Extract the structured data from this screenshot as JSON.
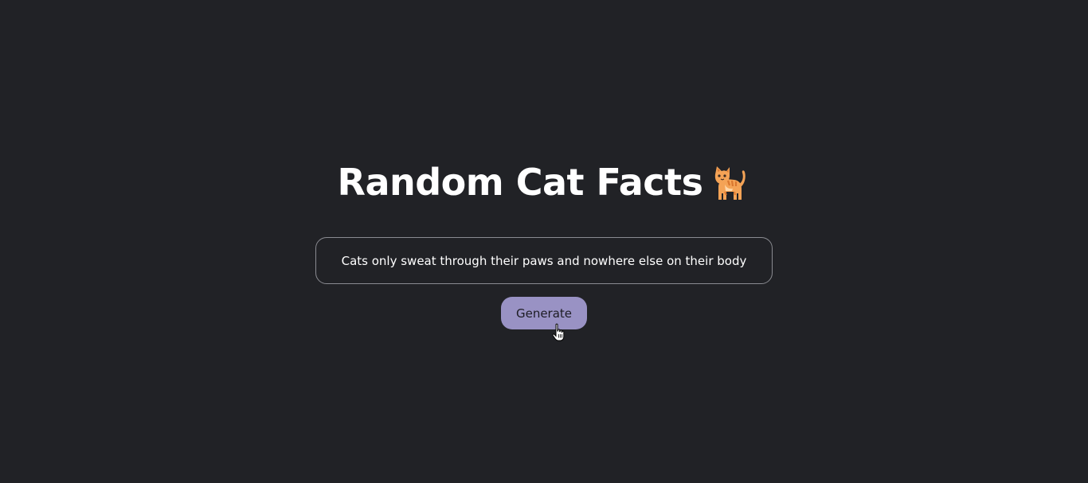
{
  "header": {
    "title": "Random Cat Facts",
    "title_icon": "cat-icon"
  },
  "fact": {
    "text": "Cats only sweat through their paws and nowhere else on their body"
  },
  "actions": {
    "generate_label": "Generate"
  },
  "colors": {
    "background": "#212226",
    "button": "#9992c4",
    "text": "#ffffff",
    "border": "#8a8b91"
  },
  "cursor": {
    "icon": "hand-pointer-icon"
  }
}
